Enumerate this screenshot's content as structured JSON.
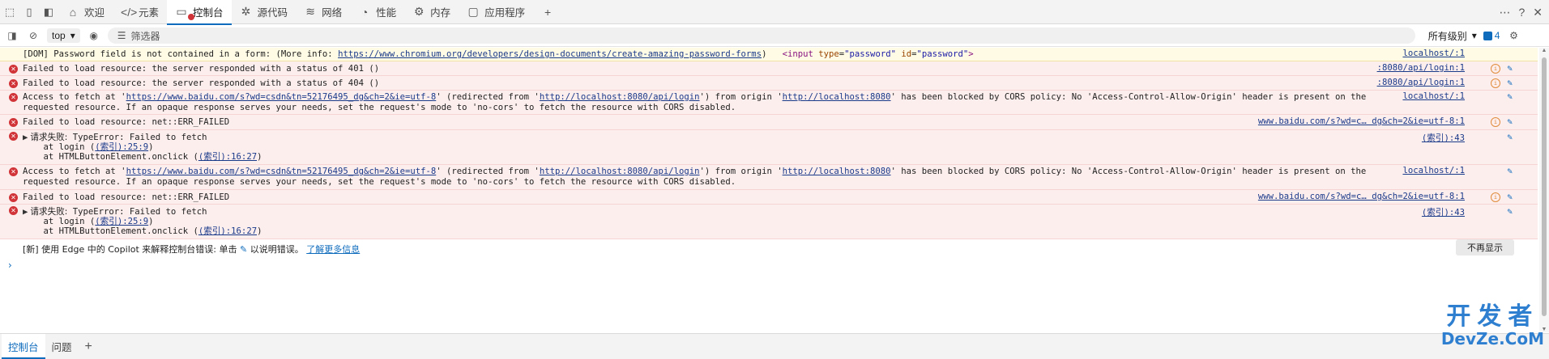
{
  "tabbar": {
    "tabs": [
      {
        "label": "欢迎",
        "icon": "home-icon"
      },
      {
        "label": "元素",
        "icon": "code-icon"
      },
      {
        "label": "控制台",
        "icon": "console-icon"
      },
      {
        "label": "源代码",
        "icon": "bug-icon"
      },
      {
        "label": "网络",
        "icon": "wifi-icon"
      },
      {
        "label": "性能",
        "icon": "performance-icon"
      },
      {
        "label": "内存",
        "icon": "memory-icon"
      },
      {
        "label": "应用程序",
        "icon": "application-icon"
      }
    ],
    "active_tab": "控制台"
  },
  "toolbar": {
    "context": "top",
    "filter_placeholder": "筛选器",
    "levels": "所有级别",
    "issue_count": "4"
  },
  "console": {
    "warning": {
      "prefix": "[DOM] Password field is not contained in a form: (More info: ",
      "url": "https://www.chromium.org/developers/design-documents/create-amazing-password-forms",
      "suffix": ")",
      "el_open": "<input",
      "a1": "type",
      "v1": "\"password\"",
      "a2": "id",
      "v2": "\"password\"",
      "el_close": ">",
      "source": "localhost/:1"
    },
    "e401": {
      "text": "Failed to load resource: the server responded with a status of 401 ()",
      "source": ":8080/api/login:1"
    },
    "e404": {
      "text": "Failed to load resource: the server responded with a status of 404 ()",
      "source": ":8080/api/login:1"
    },
    "cors": {
      "p1": "Access to fetch at '",
      "url1": "https://www.baidu.com/s?wd=csdn&tn=52176495_dg&ch=2&ie=utf-8",
      "p2": "' (redirected from '",
      "url2": "http://localhost:8080/api/login",
      "p3": "') from origin '",
      "url3": "http://localhost:8080",
      "p4": "' has been blocked by CORS policy: No 'Access-Control-Allow-Origin' header is present on the",
      "line2": "requested resource. If an opaque response serves your needs, set the request's mode to 'no-cors' to fetch the resource with CORS disabled.",
      "source": "localhost/:1"
    },
    "failed": {
      "text": "Failed to load resource: net::ERR_FAILED",
      "source": "www.baidu.com/s?wd=c… dg&ch=2&ie=utf-8:1"
    },
    "req": {
      "head": "请求失败:",
      "err": " TypeError: Failed to fetch",
      "at1_pre": "    at login (",
      "at1_link": "(索引):25:9",
      "at1_post": ")",
      "at2_pre": "    at HTMLButtonElement.onclick (",
      "at2_link": "(索引):16:27",
      "at2_post": ")",
      "source": "(索引):43"
    },
    "tip": {
      "pre": "[新] 使用 Edge 中的 Copilot 来解释控制台错误: 单击",
      "post": "以说明错误。",
      "link": "了解更多信息"
    },
    "dont_show": "不再显示"
  },
  "drawer": {
    "tabs": [
      "控制台",
      "问题"
    ],
    "active_tab": "控制台"
  },
  "watermark": {
    "line1": "开发者",
    "line2": "DevZe.CoM"
  },
  "colors": {
    "accent": "#0f6cbd",
    "error_bg": "#fdeeee",
    "warning_bg": "#fffbe5",
    "error_icon": "#d13438"
  }
}
